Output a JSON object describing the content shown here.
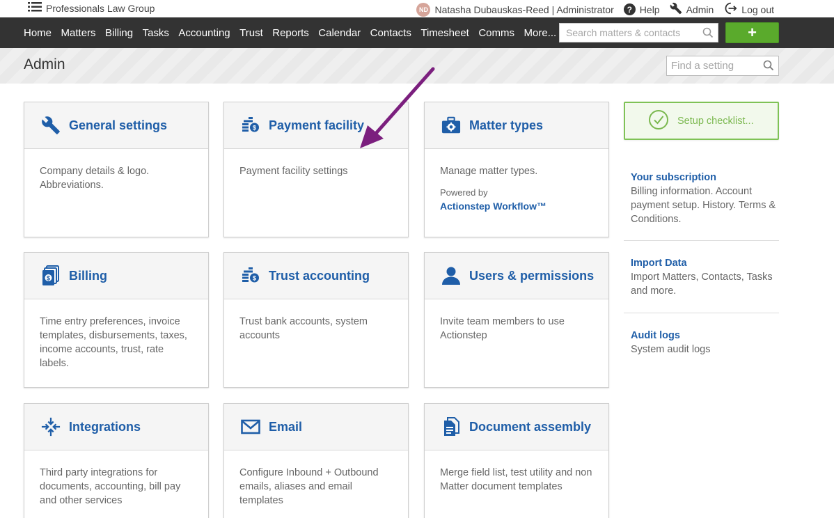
{
  "topbar": {
    "brand": "Professionals Law Group",
    "avatar_initials": "ND",
    "user": "Natasha Dubauskas-Reed | Administrator",
    "help": "Help",
    "admin": "Admin",
    "logout": "Log out"
  },
  "nav": {
    "links": [
      "Home",
      "Matters",
      "Billing",
      "Tasks",
      "Accounting",
      "Trust",
      "Reports",
      "Calendar",
      "Contacts",
      "Timesheet",
      "Comms",
      "More..."
    ],
    "search_placeholder": "Search matters & contacts",
    "add_label": "+",
    "add_color": "#5aaa2c"
  },
  "header": {
    "title": "Admin",
    "find_placeholder": "Find a setting"
  },
  "cards": [
    {
      "icon": "wrench-icon",
      "title": "General settings",
      "desc": "Company details & logo. Abbreviations."
    },
    {
      "icon": "coins-icon",
      "title": "Payment facility",
      "desc": "Payment facility settings"
    },
    {
      "icon": "toolbox-gear-icon",
      "title": "Matter types",
      "desc": "Manage matter types.",
      "powered_by": "Powered by",
      "powered_link": "Actionstep Workflow™"
    },
    {
      "icon": "money-stack-icon",
      "title": "Billing",
      "desc": "Time entry preferences, invoice templates, disbursements, taxes, income accounts, trust, rate labels."
    },
    {
      "icon": "coins-icon",
      "title": "Trust accounting",
      "desc": "Trust bank accounts, system accounts"
    },
    {
      "icon": "user-icon",
      "title": "Users & permissions",
      "desc": "Invite team members to use Actionstep"
    },
    {
      "icon": "integrations-icon",
      "title": "Integrations",
      "desc": "Third party integrations for documents, accounting, bill pay and other services"
    },
    {
      "icon": "envelope-icon",
      "title": "Email",
      "desc": "Configure Inbound + Outbound emails, aliases and email templates"
    },
    {
      "icon": "document-icon",
      "title": "Document assembly",
      "desc": "Merge field list, test utility and non Matter document templates"
    }
  ],
  "side": {
    "checklist_label": "Setup checklist...",
    "checklist_color": "#7bb84f",
    "links": [
      {
        "title": "Your subscription",
        "desc": "Billing information. Account payment setup. History. Terms & Conditions."
      },
      {
        "title": "Import Data",
        "desc": "Import Matters, Contacts, Tasks and more."
      },
      {
        "title": "Audit logs",
        "desc": "System audit logs"
      }
    ]
  },
  "colors": {
    "accent_blue": "#1f5ea8",
    "nav_bg": "#333333",
    "annotation_arrow": "#7b1f7e"
  }
}
